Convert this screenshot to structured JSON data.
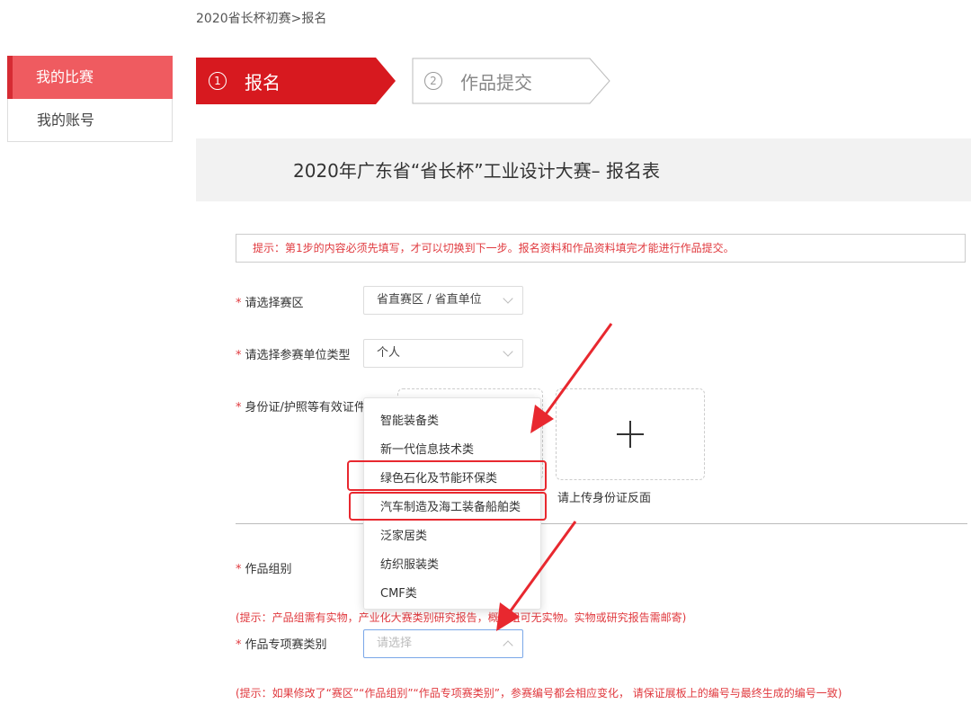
{
  "breadcrumb": "2020省长杯初赛>报名",
  "sidebar": {
    "items": [
      {
        "label": "我的比赛",
        "active": true
      },
      {
        "label": "我的账号",
        "active": false
      }
    ]
  },
  "steps": [
    {
      "number": "1",
      "label": "报名",
      "active": true
    },
    {
      "number": "2",
      "label": "作品提交",
      "active": false
    }
  ],
  "form": {
    "title": "2020年广东省“省长杯”工业设计大赛– 报名表",
    "tip": "提示：第1步的内容必须先填写，才可以切换到下一步。报名资料和作品资料填完才能进行作品提交。",
    "region": {
      "label": "请选择赛区",
      "value": "省直赛区 / 省直单位"
    },
    "unit_type": {
      "label": "请选择参赛单位类型",
      "value": "个人"
    },
    "id_doc": {
      "label": "身份证/护照等有效证件",
      "upload_back_caption": "请上传身份证反面"
    },
    "group": {
      "label": "作品组别"
    },
    "group_hint": "(提示：产品组需有实物，产业化大赛类别研究报告，概念组可无实物。实物或研究报告需邮寄)",
    "special": {
      "label": "作品专项赛类别",
      "placeholder": "请选择"
    },
    "bottom_hint": "(提示：如果修改了“赛区”“作品组别”“作品专项赛类别”，参赛编号都会相应变化， 请保证展板上的编号与最终生成的编号一致)"
  },
  "dropdown": {
    "options": [
      "智能装备类",
      "新一代信息技术类",
      "绿色石化及节能环保类",
      "汽车制造及海工装备船舶类",
      "泛家居类",
      "纺织服装类",
      "CMF类"
    ],
    "highlighted": [
      "绿色石化及节能环保类",
      "汽车制造及海工装备船舶类"
    ]
  },
  "colors": {
    "accent": "#d7191f",
    "sidebar_active": "#ef5b60",
    "hint_red": "#e0393e",
    "annotation": "#e8282f"
  }
}
